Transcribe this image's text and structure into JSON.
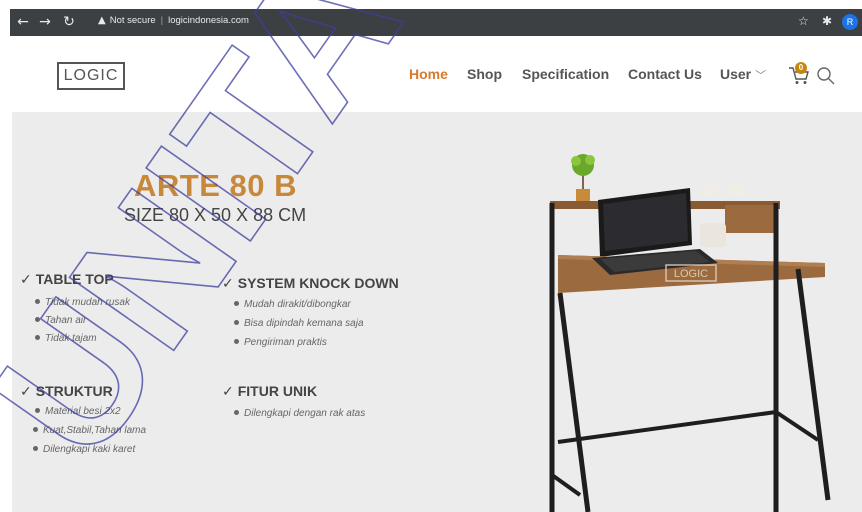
{
  "browser": {
    "security_label": "Not secure",
    "url": "logicindonesia.com",
    "profile_initial": "R"
  },
  "site": {
    "logo_text": "LOGIC",
    "nav": [
      {
        "label": "Home",
        "active": true
      },
      {
        "label": "Shop",
        "active": false
      },
      {
        "label": "Specification",
        "active": false
      },
      {
        "label": "Contact Us",
        "active": false
      },
      {
        "label": "User",
        "active": false
      }
    ],
    "cart_count": "0"
  },
  "product": {
    "title": "ARTE 80 B",
    "size": "SIZE 80 X 50 X 88 CM",
    "image_logo_text": "LOGIC",
    "features": [
      {
        "heading": "TABLE TOP",
        "bullets": [
          "Tidak mudah rusak",
          "Tahan air",
          "Tidak tajam"
        ]
      },
      {
        "heading": "SYSTEM KNOCK DOWN",
        "bullets": [
          "Mudah dirakit/dibongkar",
          "Bisa dipindah kemana saja",
          "Pengiriman praktis"
        ]
      },
      {
        "heading": "STRUKTUR",
        "bullets": [
          "Material besi 2x2",
          "Kuat,Stabil,Tahan lama",
          "Dilengkapi kaki karet"
        ]
      },
      {
        "heading": "FITUR UNIK",
        "bullets": [
          "Dilengkapi dengan rak atas"
        ]
      }
    ]
  },
  "watermark_text": "UNITAC",
  "colors": {
    "accent": "#d97a2b",
    "title": "#c8883b",
    "hero_bg": "#ececec",
    "chrome": "#3c4043"
  }
}
